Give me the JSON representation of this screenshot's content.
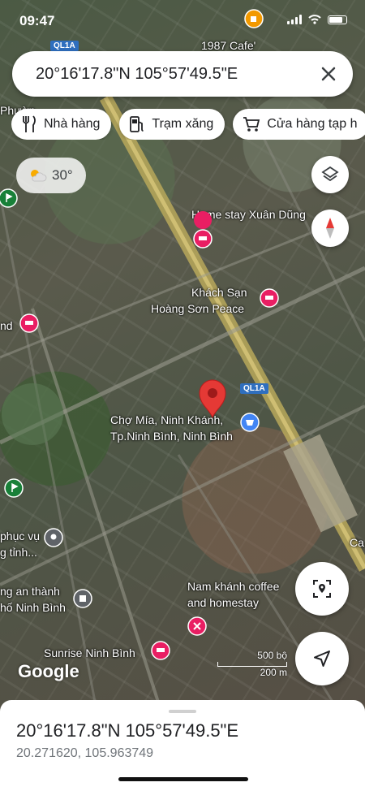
{
  "status": {
    "time": "09:47"
  },
  "search": {
    "query": "20°16'17.8\"N 105°57'49.5\"E"
  },
  "chips": [
    {
      "label": "Nhà hàng",
      "icon": "fork-knife-icon"
    },
    {
      "label": "Trạm xăng",
      "icon": "gas-station-icon"
    },
    {
      "label": "Cửa hàng tạp h",
      "icon": "shopping-cart-icon"
    }
  ],
  "weather": {
    "temp": "30°",
    "icon": "partly-cloudy-icon"
  },
  "map_labels": {
    "cafe": "1987 Cafe'",
    "homestay": "Home stay Xuân Dũng",
    "hotel_line1": "Khách Sạn",
    "hotel_line2": "Hoàng Sơn Peace",
    "market_line1": "Chợ Mía, Ninh Khánh,",
    "market_line2": "Tp.Ninh Bình, Ninh Bình",
    "nam_khanh_line1": "Nam khánh coffee",
    "nam_khanh_line2": "and homestay",
    "sunrise": "Sunrise Ninh Bình",
    "an_thanh_line1": "ng an thành",
    "an_thanh_line2": "hố Ninh Bình",
    "phuc_vu_line1": "phục vụ",
    "phuc_vu_line2": "g tỉnh...",
    "phuong": "Phườn",
    "nd": "nd",
    "ca": "Ca",
    "road_ql1a": "QL1A",
    "road_ql1a_top": "QL1A"
  },
  "scale": {
    "feet": "500 bộ",
    "meters": "200 m"
  },
  "brand": "Google",
  "sheet": {
    "title": "20°16'17.8\"N 105°57'49.5\"E",
    "decimal": "20.271620, 105.963749"
  },
  "colors": {
    "pin": "#e53935",
    "hotel_marker": "#e91e63",
    "shop_marker": "#4285f4",
    "park_marker": "#188038",
    "accent": "#1a73e8"
  }
}
